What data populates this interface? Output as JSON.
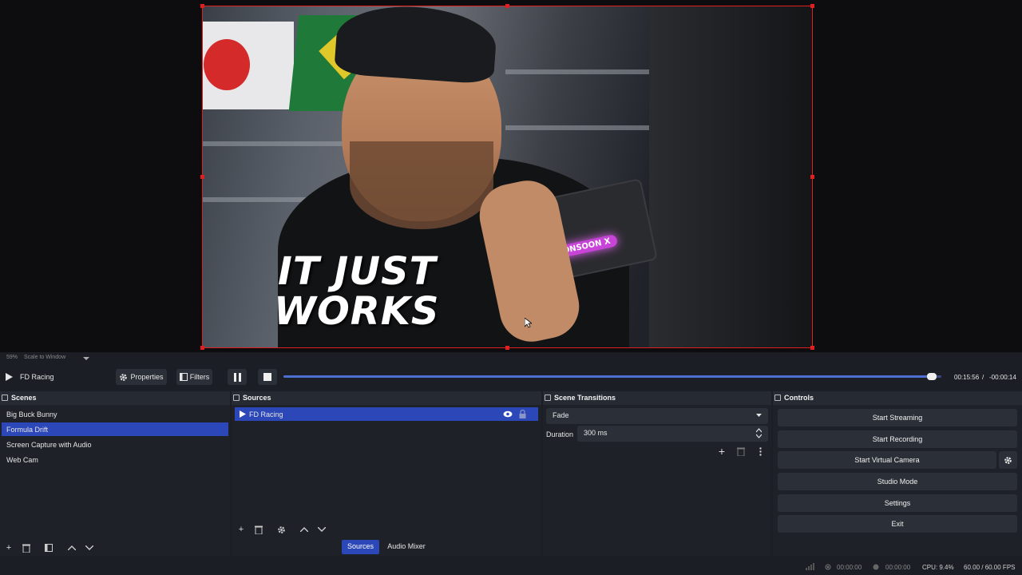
{
  "preview": {
    "overlay_line1": "IT JUST",
    "overlay_line2": "WORKS",
    "device_logo": "MONSOON X"
  },
  "zoom": {
    "percent": "59%",
    "mode": "Scale to Window"
  },
  "transport": {
    "media_name": "FD Racing",
    "properties_label": "Properties",
    "filters_label": "Filters",
    "elapsed": "00:15:56",
    "separator": "/",
    "remaining": "-00:00:14",
    "progress": 0.985
  },
  "scenes": {
    "title": "Scenes",
    "items": [
      "Big Buck Bunny",
      "Formula Drift",
      "Screen Capture with Audio",
      "Web Cam"
    ],
    "selected": "Formula Drift"
  },
  "sources": {
    "title": "Sources",
    "items": [
      "FD Racing"
    ]
  },
  "transitions": {
    "title": "Scene Transitions",
    "selected": "Fade",
    "duration_label": "Duration",
    "duration_value": "300 ms"
  },
  "controls": {
    "title": "Controls",
    "start_streaming": "Start Streaming",
    "start_recording": "Start Recording",
    "start_virtual_camera": "Start Virtual Camera",
    "studio_mode": "Studio Mode",
    "settings": "Settings",
    "exit": "Exit"
  },
  "tabs": {
    "sources": "Sources",
    "audio_mixer": "Audio Mixer"
  },
  "status": {
    "stream_time": "00:00:00",
    "rec_time": "00:00:00",
    "cpu": "CPU: 9.4%",
    "fps": "60.00 / 60.00 FPS"
  },
  "colors": {
    "accent": "#2b47b8",
    "selection_border": "#e02020",
    "seek_fill": "#4d6fd1"
  }
}
